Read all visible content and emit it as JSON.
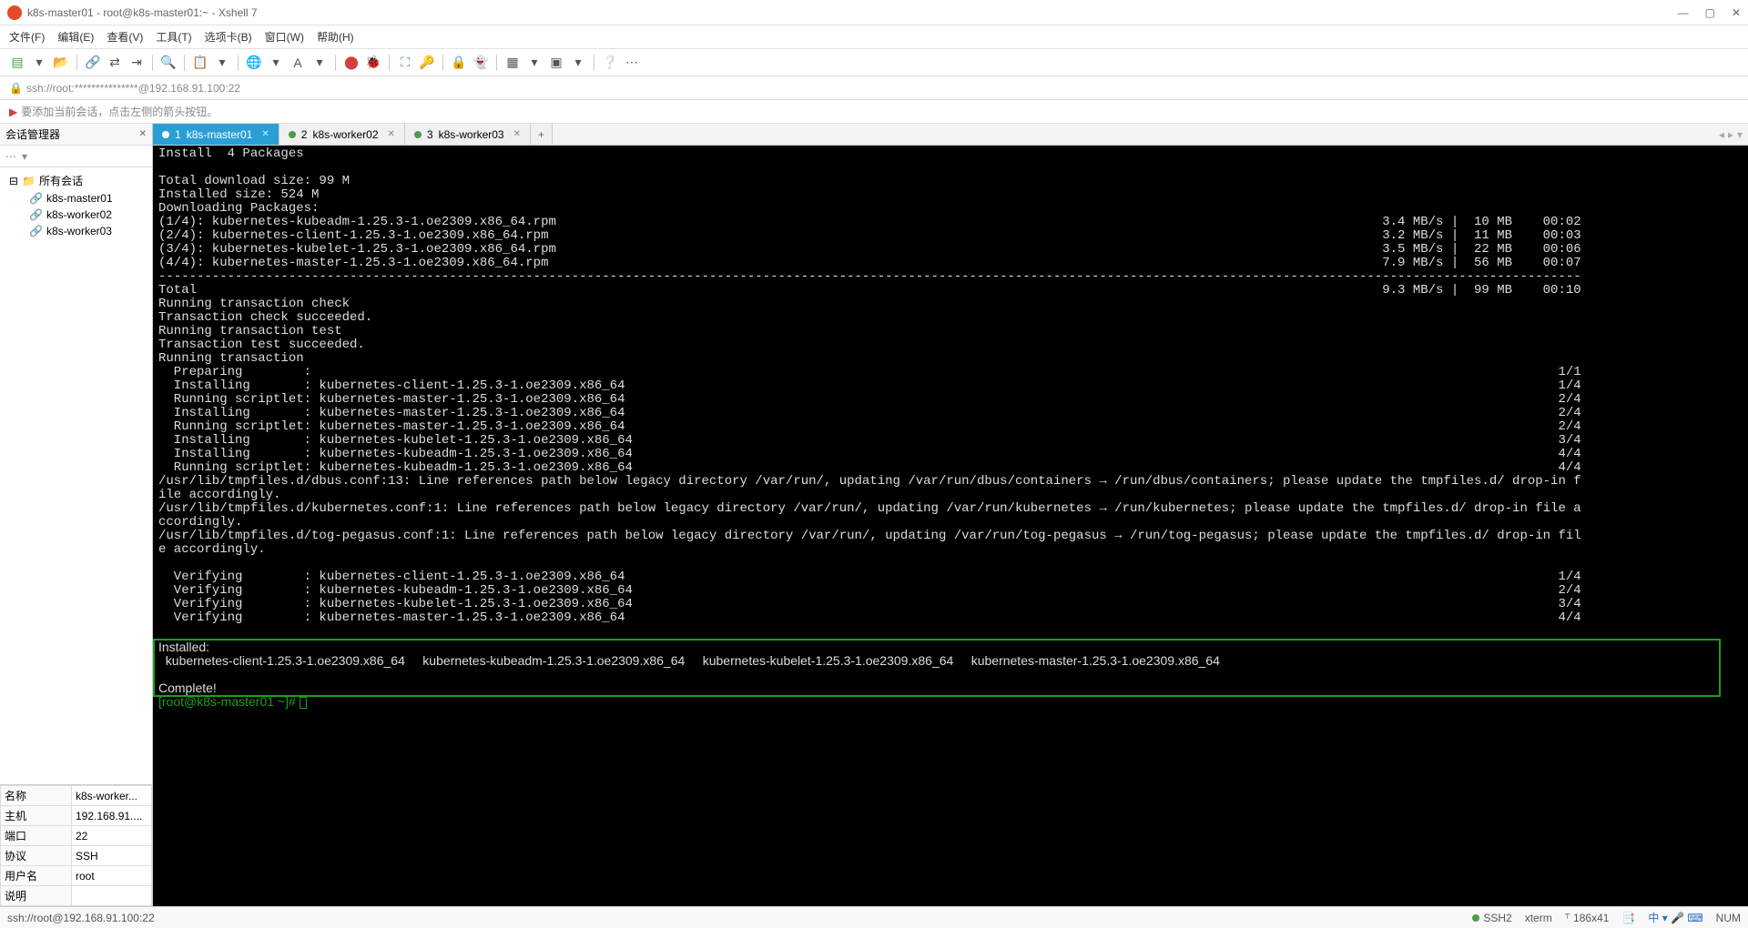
{
  "window": {
    "title": "k8s-master01 - root@k8s-master01:~ - Xshell 7"
  },
  "menus": [
    "文件(F)",
    "编辑(E)",
    "查看(V)",
    "工具(T)",
    "选项卡(B)",
    "窗口(W)",
    "帮助(H)"
  ],
  "address": "ssh://root:***************@192.168.91.100:22",
  "hint": "要添加当前会话，点击左侧的箭头按钮。",
  "sidebar": {
    "title": "会话管理器",
    "root": "所有会话",
    "items": [
      "k8s-master01",
      "k8s-worker02",
      "k8s-worker03"
    ]
  },
  "props": {
    "rows": [
      [
        "名称",
        "k8s-worker..."
      ],
      [
        "主机",
        "192.168.91...."
      ],
      [
        "端口",
        "22"
      ],
      [
        "协议",
        "SSH"
      ],
      [
        "用户名",
        "root"
      ],
      [
        "说明",
        ""
      ]
    ]
  },
  "tabs": [
    {
      "num": "1",
      "label": "k8s-master01",
      "active": true
    },
    {
      "num": "2",
      "label": "k8s-worker02",
      "active": false
    },
    {
      "num": "3",
      "label": "k8s-worker03",
      "active": false
    }
  ],
  "terminal": {
    "top": "Install  4 Packages\n\nTotal download size: 99 M\nInstalled size: 524 M\nDownloading Packages:",
    "dl": [
      {
        "l": "(1/4): kubernetes-kubeadm-1.25.3-1.oe2309.x86_64.rpm",
        "r": "3.4 MB/s |  10 MB    00:02"
      },
      {
        "l": "(2/4): kubernetes-client-1.25.3-1.oe2309.x86_64.rpm",
        "r": "3.2 MB/s |  11 MB    00:03"
      },
      {
        "l": "(3/4): kubernetes-kubelet-1.25.3-1.oe2309.x86_64.rpm",
        "r": "3.5 MB/s |  22 MB    00:06"
      },
      {
        "l": "(4/4): kubernetes-master-1.25.3-1.oe2309.x86_64.rpm",
        "r": "7.9 MB/s |  56 MB    00:07"
      }
    ],
    "total": {
      "l": "Total",
      "r": "9.3 MB/s |  99 MB    00:10"
    },
    "mid": "Running transaction check\nTransaction check succeeded.\nRunning transaction test\nTransaction test succeeded.\nRunning transaction",
    "steps": [
      {
        "l": "  Preparing        :",
        "r": "1/1"
      },
      {
        "l": "  Installing       : kubernetes-client-1.25.3-1.oe2309.x86_64",
        "r": "1/4"
      },
      {
        "l": "  Running scriptlet: kubernetes-master-1.25.3-1.oe2309.x86_64",
        "r": "2/4"
      },
      {
        "l": "  Installing       : kubernetes-master-1.25.3-1.oe2309.x86_64",
        "r": "2/4"
      },
      {
        "l": "  Running scriptlet: kubernetes-master-1.25.3-1.oe2309.x86_64",
        "r": "2/4"
      },
      {
        "l": "  Installing       : kubernetes-kubelet-1.25.3-1.oe2309.x86_64",
        "r": "3/4"
      },
      {
        "l": "  Installing       : kubernetes-kubeadm-1.25.3-1.oe2309.x86_64",
        "r": "4/4"
      },
      {
        "l": "  Running scriptlet: kubernetes-kubeadm-1.25.3-1.oe2309.x86_64",
        "r": "4/4"
      }
    ],
    "warn": "/usr/lib/tmpfiles.d/dbus.conf:13: Line references path below legacy directory /var/run/, updating /var/run/dbus/containers → /run/dbus/containers; please update the tmpfiles.d/ drop-in f\nile accordingly.\n/usr/lib/tmpfiles.d/kubernetes.conf:1: Line references path below legacy directory /var/run/, updating /var/run/kubernetes → /run/kubernetes; please update the tmpfiles.d/ drop-in file a\nccordingly.\n/usr/lib/tmpfiles.d/tog-pegasus.conf:1: Line references path below legacy directory /var/run/, updating /var/run/tog-pegasus → /run/tog-pegasus; please update the tmpfiles.d/ drop-in fil\ne accordingly.\n",
    "verify": [
      {
        "l": "  Verifying        : kubernetes-client-1.25.3-1.oe2309.x86_64",
        "r": "1/4"
      },
      {
        "l": "  Verifying        : kubernetes-kubeadm-1.25.3-1.oe2309.x86_64",
        "r": "2/4"
      },
      {
        "l": "  Verifying        : kubernetes-kubelet-1.25.3-1.oe2309.x86_64",
        "r": "3/4"
      },
      {
        "l": "  Verifying        : kubernetes-master-1.25.3-1.oe2309.x86_64",
        "r": "4/4"
      }
    ],
    "installed_hdr": "Installed:",
    "installed_line": "  kubernetes-client-1.25.3-1.oe2309.x86_64     kubernetes-kubeadm-1.25.3-1.oe2309.x86_64     kubernetes-kubelet-1.25.3-1.oe2309.x86_64     kubernetes-master-1.25.3-1.oe2309.x86_64",
    "complete": "Complete!",
    "prompt": "[root@k8s-master01 ~]# "
  },
  "status": {
    "left": "ssh://root@192.168.91.100:22",
    "ssh": "SSH2",
    "term": "xterm",
    "size": "186x41",
    "extra": "NUM"
  }
}
